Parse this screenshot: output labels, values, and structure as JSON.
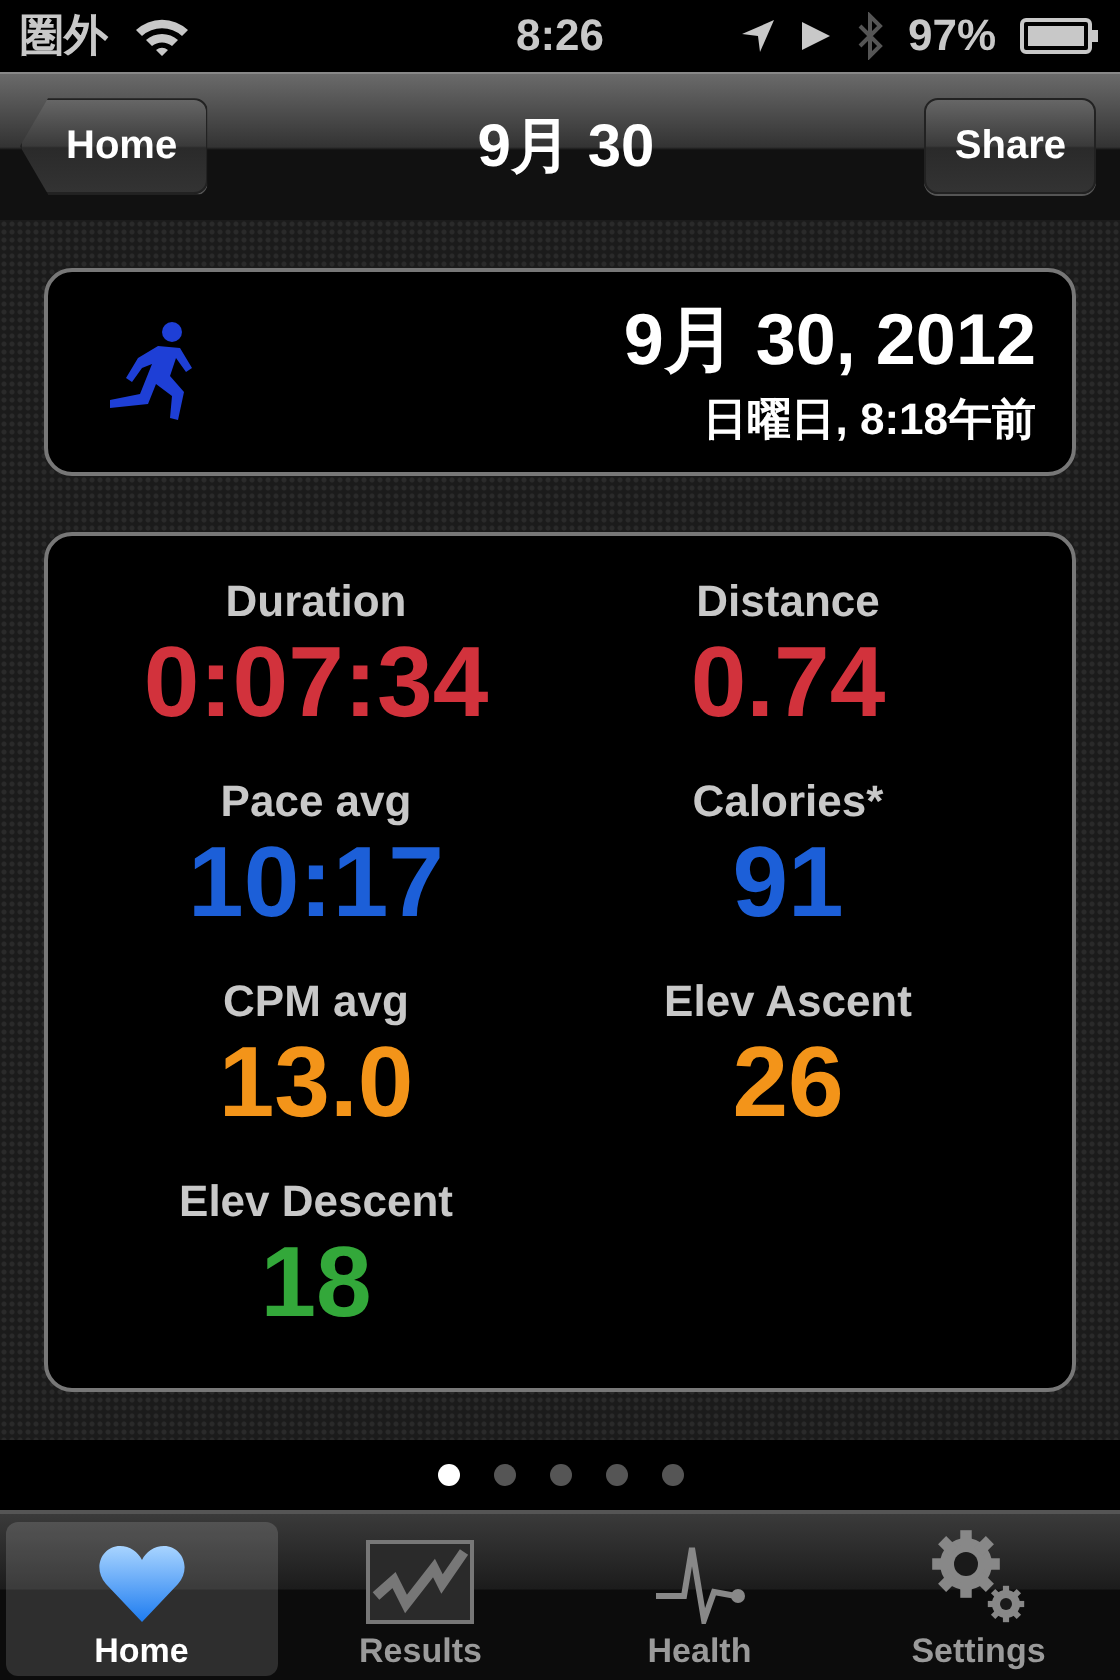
{
  "status_bar": {
    "carrier": "圏外",
    "time": "8:26",
    "battery": "97%"
  },
  "nav_bar": {
    "back": "Home",
    "title": "9月 30",
    "action": "Share"
  },
  "date_card": {
    "date": "9月 30, 2012",
    "day_time": "日曜日, 8:18午前"
  },
  "stats": [
    {
      "label": "Duration",
      "value": "0:07:34",
      "color": "#d2323c"
    },
    {
      "label": "Distance",
      "value": "0.74",
      "color": "#d2323c"
    },
    {
      "label": "Pace avg",
      "value": "10:17",
      "color": "#1c5fd8"
    },
    {
      "label": "Calories*",
      "value": "91",
      "color": "#1c5fd8"
    },
    {
      "label": "CPM avg",
      "value": "13.0",
      "color": "#f39419"
    },
    {
      "label": "Elev Ascent",
      "value": "26",
      "color": "#f39419"
    },
    {
      "label": "Elev Descent",
      "value": "18",
      "color": "#33a83a"
    }
  ],
  "pages": [
    {
      "selected": true
    },
    {
      "selected": false
    },
    {
      "selected": false
    },
    {
      "selected": false
    },
    {
      "selected": false
    }
  ],
  "tabs": [
    {
      "label": "Home",
      "kind": "heart",
      "selected": true
    },
    {
      "label": "Results",
      "kind": "chart",
      "selected": false
    },
    {
      "label": "Health",
      "kind": "pulse",
      "selected": false
    },
    {
      "label": "Settings",
      "kind": "gear",
      "selected": false
    }
  ]
}
